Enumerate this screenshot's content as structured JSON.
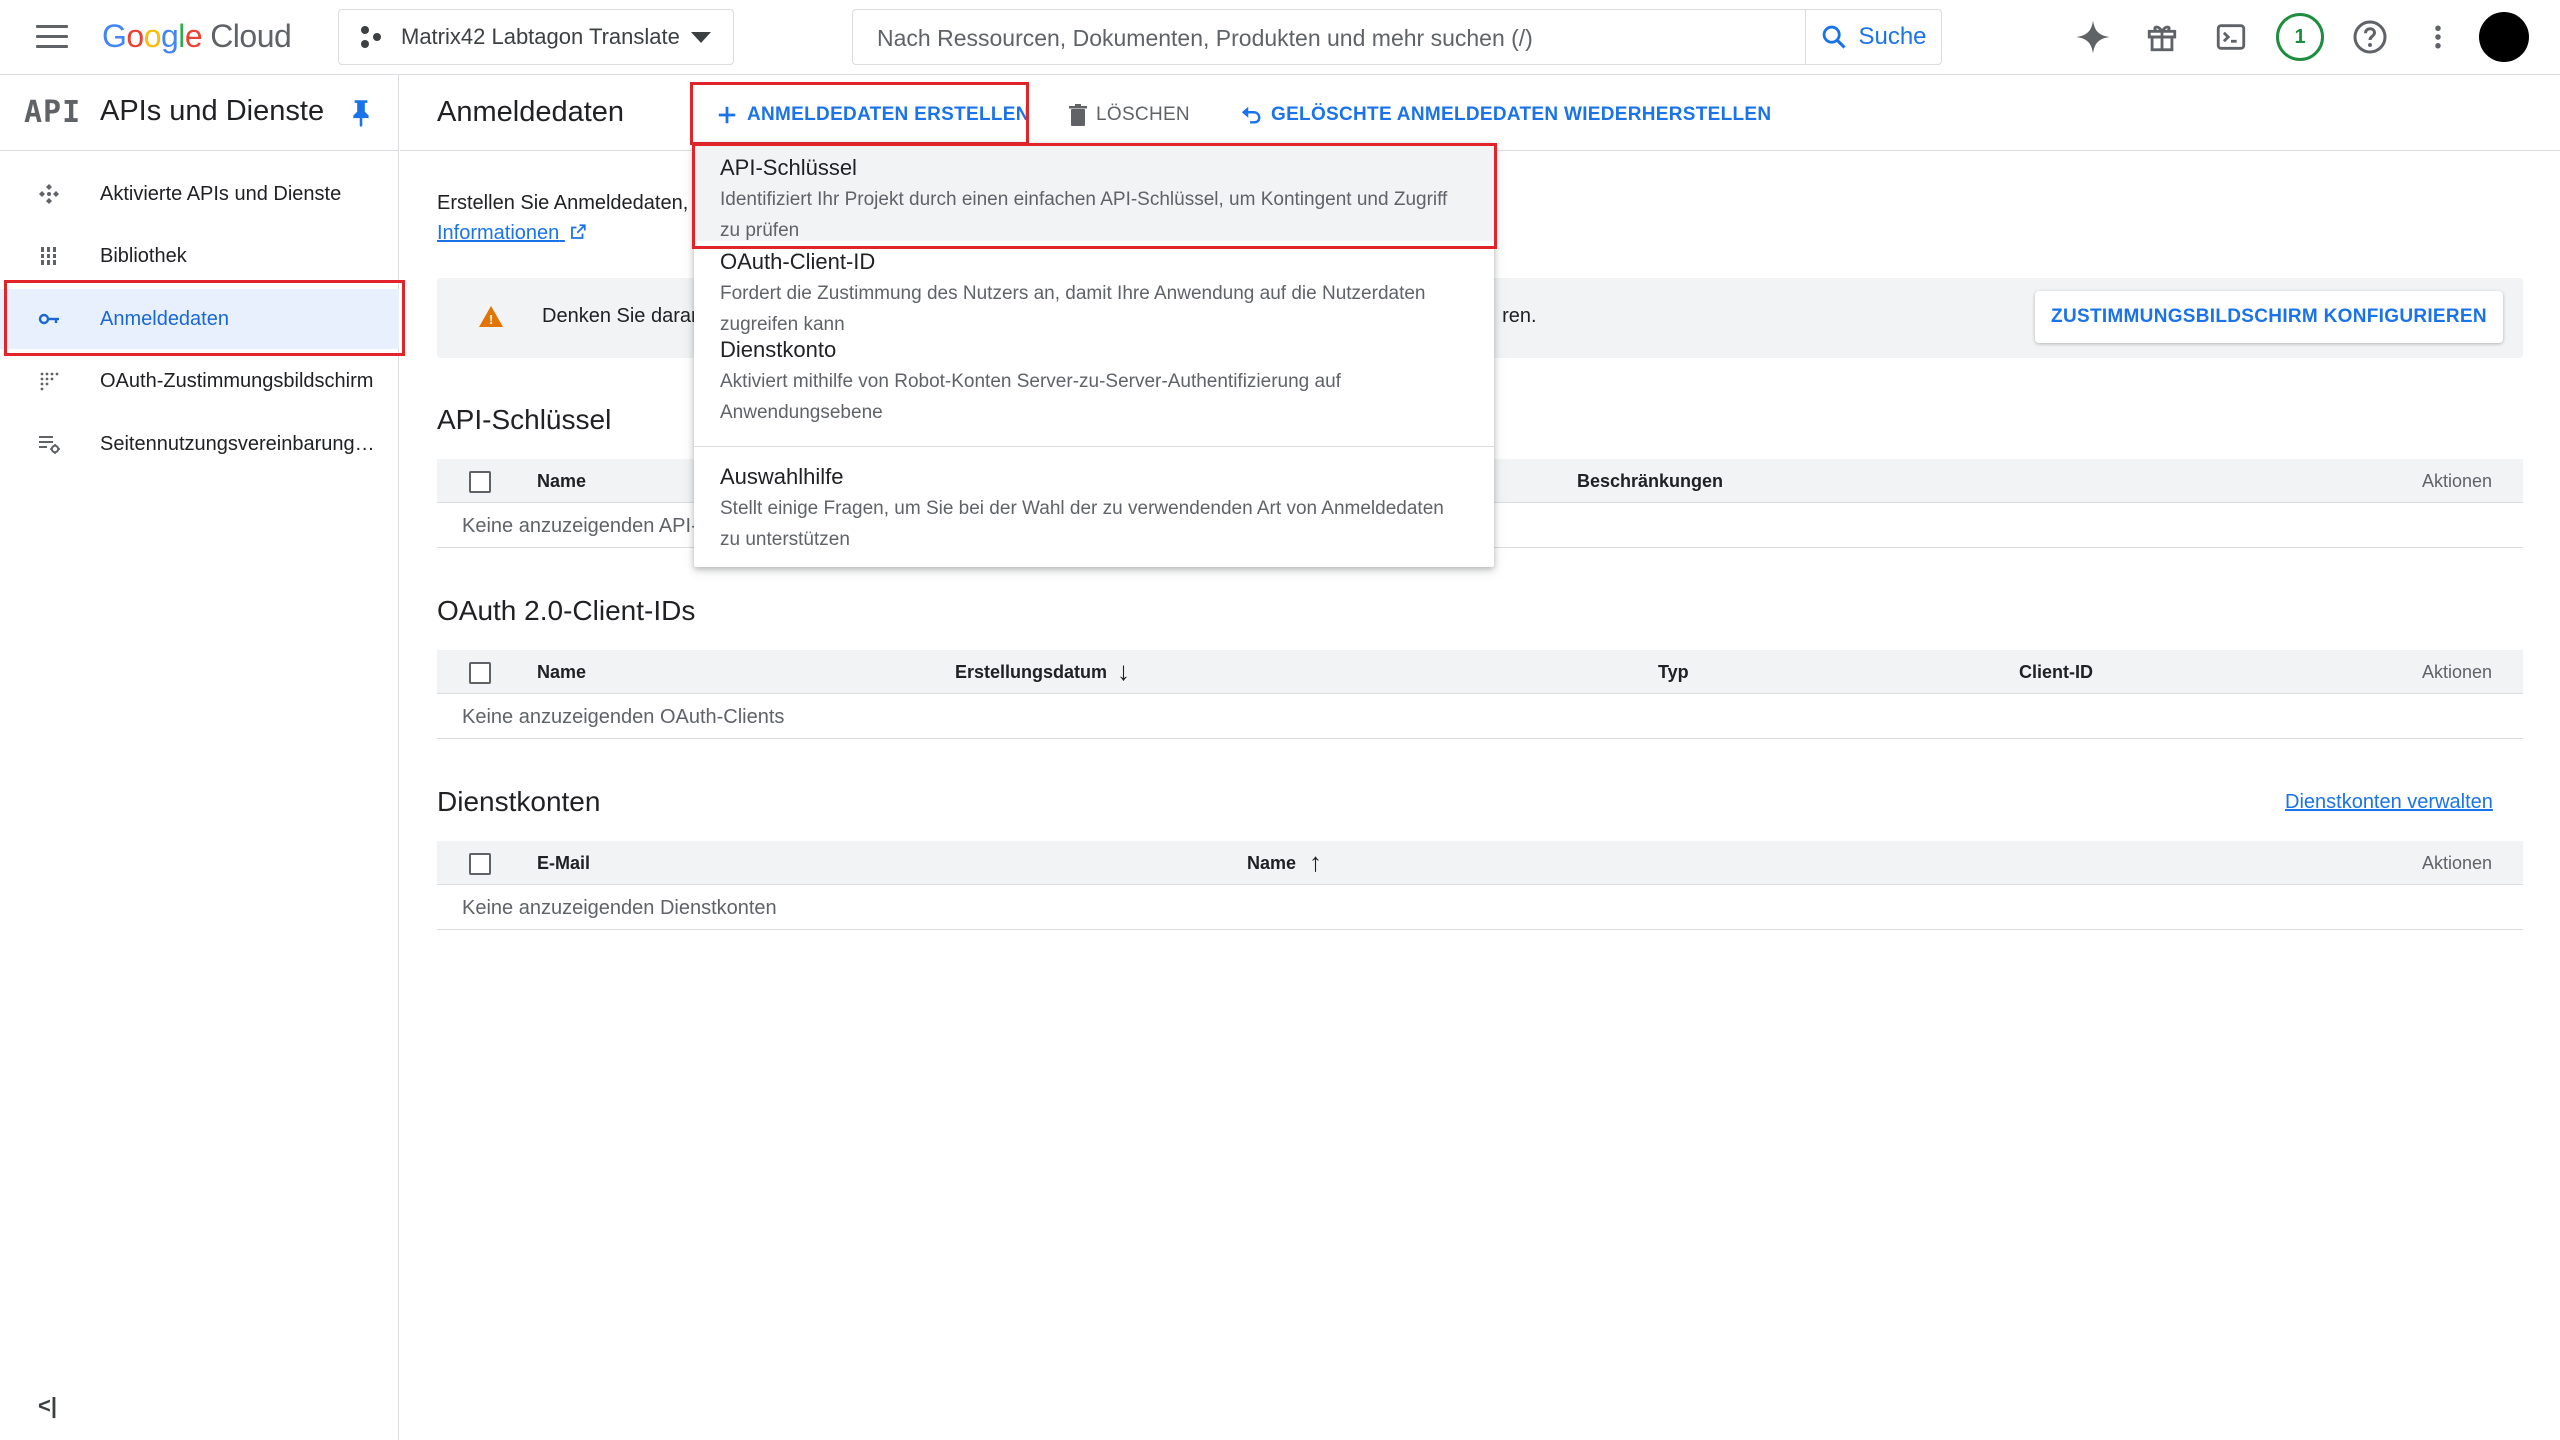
{
  "topbar": {
    "logo": {
      "g1": "G",
      "g2": "o",
      "g3": "o",
      "g4": "g",
      "g5": "l",
      "g6": "e",
      "cloud": "Cloud"
    },
    "project_name": "Matrix42 Labtagon Translate",
    "search_placeholder": "Nach Ressourcen, Dokumenten, Produkten und mehr suchen (/)",
    "search_button": "Suche",
    "notification_count": "1",
    "icons": [
      "menu-icon",
      "project-icon",
      "search-icon",
      "gemini-icon",
      "gift-icon",
      "terminal-icon",
      "help-icon",
      "more-vert-icon"
    ]
  },
  "sidebar": {
    "api_logo": "API",
    "title": "APIs und Dienste",
    "items": [
      {
        "label": "Aktivierte APIs und Dienste",
        "icon": "apis-icon"
      },
      {
        "label": "Bibliothek",
        "icon": "library-icon"
      },
      {
        "label": "Anmeldedaten",
        "icon": "key-icon",
        "active": true
      },
      {
        "label": "OAuth-Zustimmungsbildschirm",
        "icon": "consent-icon"
      },
      {
        "label": "Seitennutzungsvereinbarungen",
        "icon": "agreements-icon"
      }
    ],
    "collapse_label": "<|"
  },
  "main": {
    "title": "Anmeldedaten",
    "create_button": "ANMELDEDATEN ERSTELLEN",
    "delete_button": "LÖSCHEN",
    "restore_button": "GELÖSCHTE ANMELDEDATEN WIEDERHERSTELLEN",
    "intro_text": "Erstellen Sie Anmeldedaten,",
    "intro_link": "Informationen",
    "banner_text_start": "Denken Sie daran",
    "banner_text_end": "ren.",
    "banner_button": "ZUSTIMMUNGSBILDSCHIRM KONFIGURIEREN",
    "api_keys": {
      "title": "API-Schlüssel",
      "columns": [
        "Name",
        "Beschränkungen",
        "Aktionen"
      ],
      "empty": "Keine anzuzeigenden API-"
    },
    "oauth": {
      "title": "OAuth 2.0-Client-IDs",
      "columns": [
        "Name",
        "Erstellungsdatum",
        "Typ",
        "Client-ID",
        "Aktionen"
      ],
      "empty": "Keine anzuzeigenden OAuth-Clients"
    },
    "service_accounts": {
      "title": "Dienstkonten",
      "manage_link": "Dienstkonten verwalten",
      "columns": [
        "E-Mail",
        "Name",
        "Aktionen"
      ],
      "empty": "Keine anzuzeigenden Dienstkonten"
    }
  },
  "dropdown": {
    "items": [
      {
        "title": "API-Schlüssel",
        "desc": "Identifiziert Ihr Projekt durch einen einfachen API-Schlüssel, um Kontingent und Zugriff zu prüfen"
      },
      {
        "title": "OAuth-Client-ID",
        "desc": "Fordert die Zustimmung des Nutzers an, damit Ihre Anwendung auf die Nutzerdaten zugreifen kann"
      },
      {
        "title": "Dienstkonto",
        "desc": "Aktiviert mithilfe von Robot-Konten Server-zu-Server-Authentifizierung auf Anwendungsebene"
      },
      {
        "title": "Auswahlhilfe",
        "desc": "Stellt einige Fragen, um Sie bei der Wahl der zu verwendenden Art von Anmeldedaten zu unterstützen"
      }
    ]
  },
  "colors": {
    "accent": "#1a73e8",
    "highlight_box": "#e0242a",
    "warning": "#e37400",
    "status_green": "#1e8e3e"
  }
}
